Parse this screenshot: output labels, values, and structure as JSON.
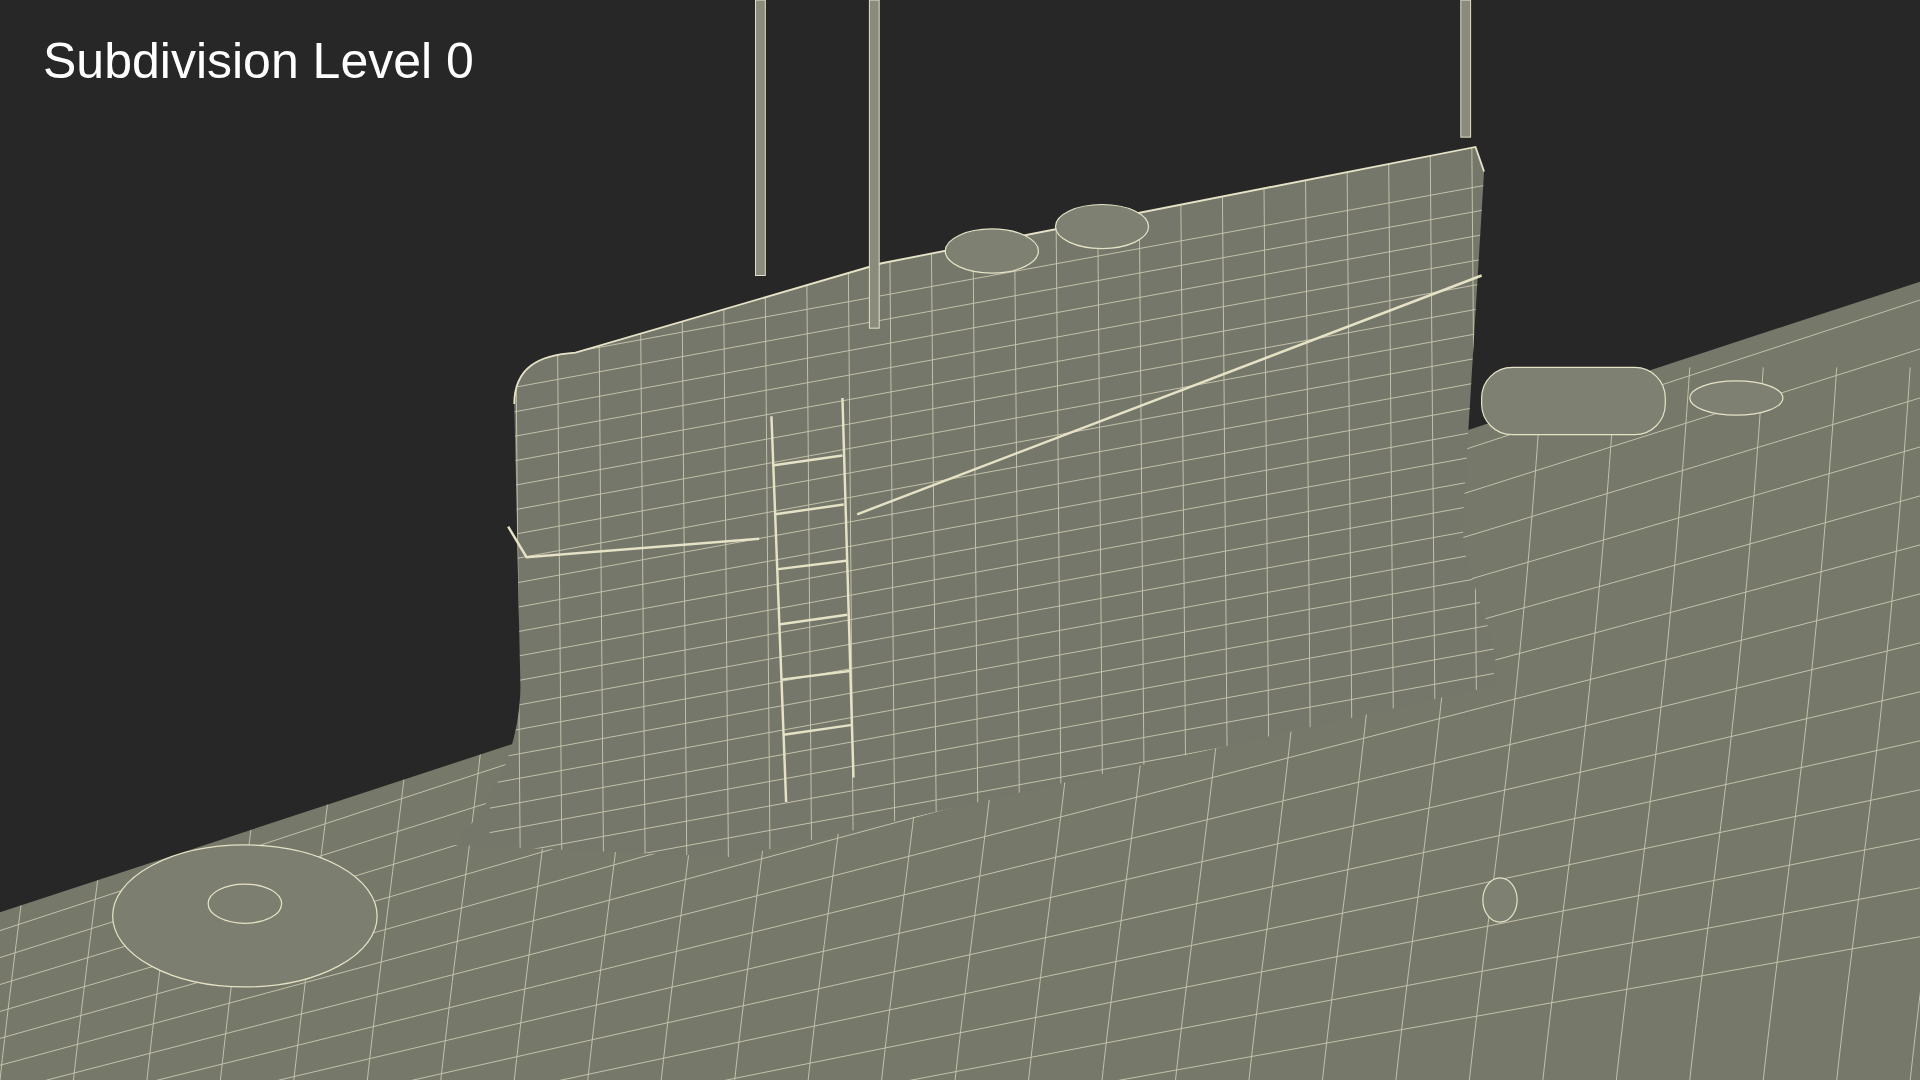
{
  "caption": {
    "text": "Subdivision Level 0"
  }
}
